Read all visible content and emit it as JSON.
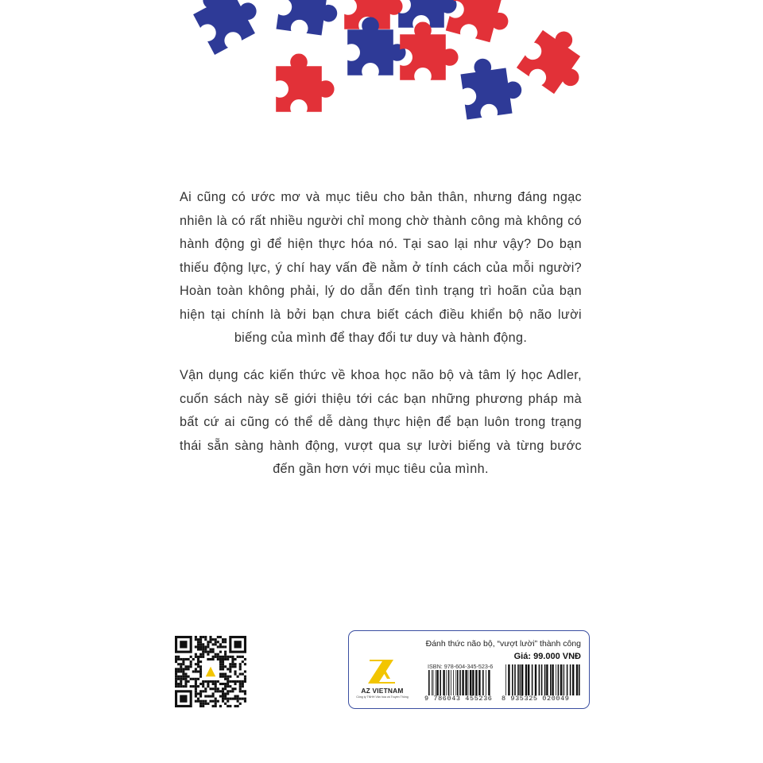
{
  "description": {
    "paragraph1": "Ai cũng có ước mơ và mục tiêu cho bản thân, nhưng đáng ngạc nhiên là có rất nhiều người chỉ mong chờ thành công mà không có hành động gì để hiện thực hóa nó. Tại sao lại như vậy? Do bạn thiếu động lực, ý chí hay vấn đề nằm ở tính cách của mỗi người? Hoàn toàn không phải, lý do dẫn đến tình trạng trì hoãn của bạn hiện tại chính là bởi bạn chưa biết cách điều khiển bộ não lười biếng của mình để thay đổi tư duy và hành động.",
    "paragraph2": "Vận dụng các kiến thức về khoa học não bộ và tâm lý học Adler, cuốn sách này sẽ giới thiệu tới các bạn những phương pháp mà bất cứ ai cũng có thể dễ dàng thực hiện để bạn luôn trong trạng thái sẵn sàng hành động, vượt qua sự lười biếng và từng bước đến gần hơn với mục tiêu của mình."
  },
  "price_box": {
    "book_title": "Đánh thức não bộ, “vượt lười” thành công",
    "price": "Giá: 99.000 VNĐ",
    "isbn": "ISBN: 978-604-345-523-6",
    "barcode1_number": "9 786043 455236",
    "barcode2_number": "8 935325 020049"
  },
  "publisher": {
    "name": "AZ VIETNAM",
    "subtitle": "Công ty TNHH Văn hóa và Truyền Thông"
  },
  "colors": {
    "puzzle_blue": "#2e3a97",
    "puzzle_red": "#e23138",
    "logo_yellow": "#f2c500",
    "box_border": "#3b4fa1",
    "text": "#333333"
  },
  "icons": [
    "puzzle-piece-icon",
    "qr-code-icon",
    "barcode-icon",
    "az-vietnam-logo-icon"
  ]
}
